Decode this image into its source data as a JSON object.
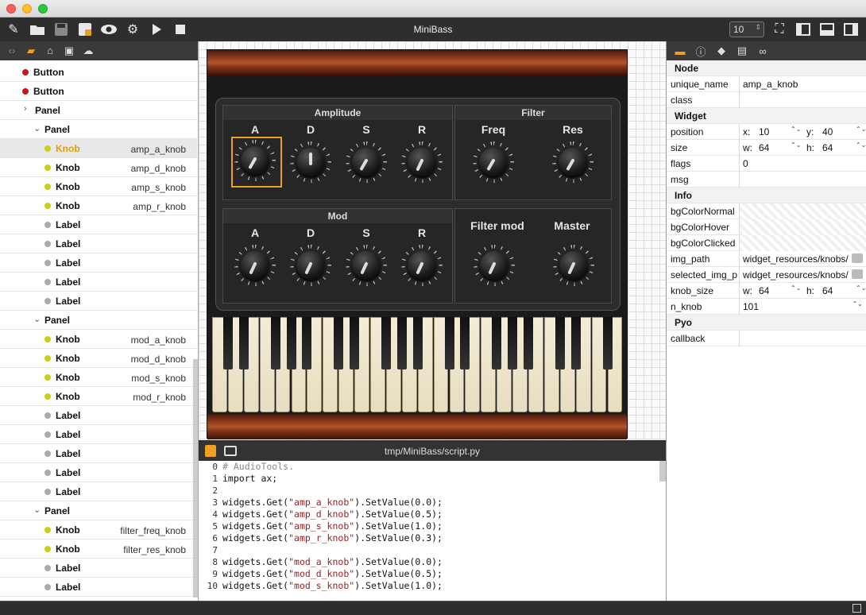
{
  "app_title": "MiniBass",
  "zoom_value": "10",
  "tree": [
    {
      "kind": "Button",
      "level": 1,
      "dot": "red"
    },
    {
      "kind": "Button",
      "level": 1,
      "dot": "red"
    },
    {
      "kind": "Panel",
      "level": 1,
      "arrow": "collapsed"
    },
    {
      "kind": "Panel",
      "level": 2,
      "arrow": "expanded"
    },
    {
      "kind": "Knob",
      "level": 3,
      "dot": "yellow",
      "id": "amp_a_knob",
      "selected": true
    },
    {
      "kind": "Knob",
      "level": 3,
      "dot": "yellow",
      "id": "amp_d_knob"
    },
    {
      "kind": "Knob",
      "level": 3,
      "dot": "yellow",
      "id": "amp_s_knob"
    },
    {
      "kind": "Knob",
      "level": 3,
      "dot": "yellow",
      "id": "amp_r_knob"
    },
    {
      "kind": "Label",
      "level": 3,
      "dot": "gray"
    },
    {
      "kind": "Label",
      "level": 3,
      "dot": "gray"
    },
    {
      "kind": "Label",
      "level": 3,
      "dot": "gray"
    },
    {
      "kind": "Label",
      "level": 3,
      "dot": "gray"
    },
    {
      "kind": "Label",
      "level": 3,
      "dot": "gray"
    },
    {
      "kind": "Panel",
      "level": 2,
      "arrow": "expanded"
    },
    {
      "kind": "Knob",
      "level": 3,
      "dot": "yellow",
      "id": "mod_a_knob"
    },
    {
      "kind": "Knob",
      "level": 3,
      "dot": "yellow",
      "id": "mod_d_knob"
    },
    {
      "kind": "Knob",
      "level": 3,
      "dot": "yellow",
      "id": "mod_s_knob"
    },
    {
      "kind": "Knob",
      "level": 3,
      "dot": "yellow",
      "id": "mod_r_knob"
    },
    {
      "kind": "Label",
      "level": 3,
      "dot": "gray"
    },
    {
      "kind": "Label",
      "level": 3,
      "dot": "gray"
    },
    {
      "kind": "Label",
      "level": 3,
      "dot": "gray"
    },
    {
      "kind": "Label",
      "level": 3,
      "dot": "gray"
    },
    {
      "kind": "Label",
      "level": 3,
      "dot": "gray"
    },
    {
      "kind": "Panel",
      "level": 2,
      "arrow": "expanded"
    },
    {
      "kind": "Knob",
      "level": 3,
      "dot": "yellow",
      "id": "filter_freq_knob"
    },
    {
      "kind": "Knob",
      "level": 3,
      "dot": "yellow",
      "id": "filter_res_knob"
    },
    {
      "kind": "Label",
      "level": 3,
      "dot": "gray"
    },
    {
      "kind": "Label",
      "level": 3,
      "dot": "gray"
    }
  ],
  "synth": {
    "groups": {
      "amplitude": "Amplitude",
      "filter": "Filter",
      "mod": "Mod"
    },
    "amp_labels": [
      "A",
      "D",
      "S",
      "R"
    ],
    "filter_labels": [
      "Freq",
      "Res"
    ],
    "mod_labels": [
      "A",
      "D",
      "S",
      "R"
    ],
    "bottom_right_labels": [
      "Filter mod",
      "Master"
    ]
  },
  "editor": {
    "path": "tmp/MiniBass/script.py",
    "lines": [
      {
        "n": "0",
        "code": "# AudioTools."
      },
      {
        "n": "1",
        "code": "import ax;"
      },
      {
        "n": "2",
        "code": ""
      },
      {
        "n": "3",
        "code": "widgets.Get(\"amp_a_knob\").SetValue(0.0);"
      },
      {
        "n": "4",
        "code": "widgets.Get(\"amp_d_knob\").SetValue(0.5);"
      },
      {
        "n": "5",
        "code": "widgets.Get(\"amp_s_knob\").SetValue(1.0);"
      },
      {
        "n": "6",
        "code": "widgets.Get(\"amp_r_knob\").SetValue(0.3);"
      },
      {
        "n": "7",
        "code": ""
      },
      {
        "n": "8",
        "code": "widgets.Get(\"mod_a_knob\").SetValue(0.0);"
      },
      {
        "n": "9",
        "code": "widgets.Get(\"mod_d_knob\").SetValue(0.5);"
      },
      {
        "n": "10",
        "code": "widgets.Get(\"mod_s_knob\").SetValue(1.0);"
      }
    ]
  },
  "props": {
    "node_section": "Node",
    "unique_name_label": "unique_name",
    "unique_name_value": "amp_a_knob",
    "class_label": "class",
    "class_value": "",
    "widget_section": "Widget",
    "position_label": "position",
    "pos_x_label": "x:",
    "pos_x": "10",
    "pos_y_label": "y:",
    "pos_y": "40",
    "size_label": "size",
    "size_w_label": "w:",
    "size_w": "64",
    "size_h_label": "h:",
    "size_h": "64",
    "flags_label": "flags",
    "flags_value": "0",
    "msg_label": "msg",
    "msg_value": "",
    "info_section": "Info",
    "bg_normal_label": "bgColorNormal",
    "bg_hover_label": "bgColorHover",
    "bg_clicked_label": "bgColorClicked",
    "img_path_label": "img_path",
    "img_path_value": "widget_resources/knobs/",
    "selected_img_label": "selected_img_p",
    "selected_img_value": "widget_resources/knobs/",
    "knob_size_label": "knob_size",
    "knob_w_label": "w:",
    "knob_w": "64",
    "knob_h_label": "h:",
    "knob_h": "64",
    "n_knob_label": "n_knob",
    "n_knob_value": "101",
    "pyo_section": "Pyo",
    "callback_label": "callback",
    "callback_value": ""
  },
  "colors": {
    "red": "#c8161b",
    "yellow": "#c9d21b",
    "gray": "#aaaaaa",
    "selected_text": "#e0a000",
    "accent": "#f0a020"
  }
}
